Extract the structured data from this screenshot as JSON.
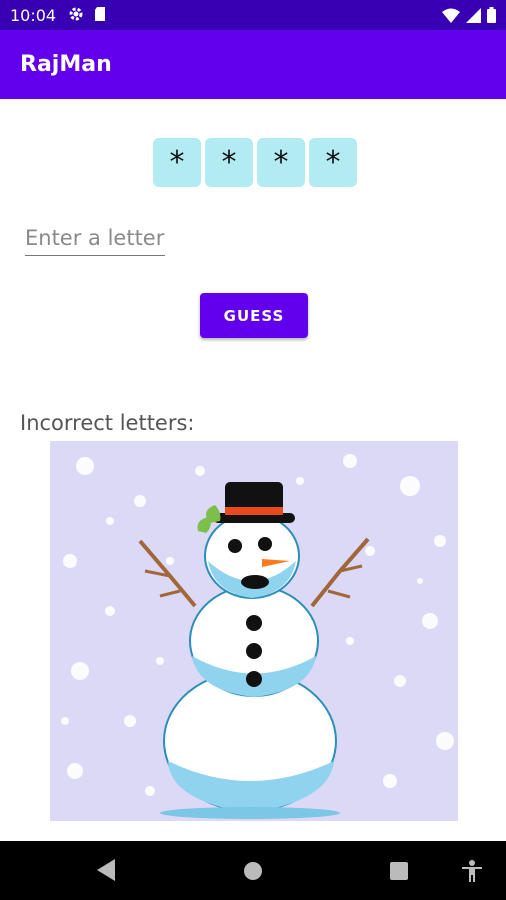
{
  "status_bar": {
    "time": "10:04",
    "icons_left": [
      "settings-icon",
      "sd-card-icon"
    ],
    "icons_right": [
      "wifi-icon",
      "signal-icon",
      "battery-icon"
    ]
  },
  "app_bar": {
    "title": "RajMan"
  },
  "word": {
    "letters": [
      "*",
      "*",
      "*",
      "*"
    ]
  },
  "input": {
    "placeholder": "Enter a letter",
    "value": ""
  },
  "guess_button": {
    "label": "GUESS"
  },
  "incorrect": {
    "label": "Incorrect letters:"
  },
  "image": {
    "description_icon": "snowman-image"
  },
  "nav_bar": {
    "buttons": [
      "back-icon",
      "home-icon",
      "recents-icon",
      "accessibility-icon"
    ]
  },
  "colors": {
    "status_bar": "#3700b3",
    "app_bar": "#6200ee",
    "letter_box": "#b2ebf2",
    "button": "#6200ee"
  }
}
